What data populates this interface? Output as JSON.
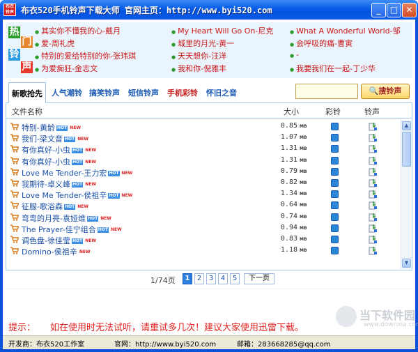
{
  "window": {
    "icon_text": "布衣\n铃声",
    "title": "布衣520手机铃声下载大师   官网主页：http://www.byi520.com"
  },
  "hot_logo": [
    "热",
    "门",
    "铃",
    "声"
  ],
  "hot_links": [
    "其实你不懂我的心-戴月",
    "My Heart Will Go On-尼克",
    "What A Wonderful World-邹",
    "爱-周礼虎",
    "城里的月光-黄一",
    "会呼吸的痛-曹寅",
    "特别的爱给特别的你-张玮琪",
    "天天想你-汪洋",
    "-",
    "为爱痴狂-金志文",
    "我和你-倪雅丰",
    "我要我们在一起-丁少华"
  ],
  "tabs": [
    "新歌抢先",
    "人气潮铃",
    "搞笑铃声",
    "短信铃声",
    "手机彩铃",
    "怀旧之音"
  ],
  "search": {
    "placeholder": "",
    "button_label": "搜铃声"
  },
  "table": {
    "headers": {
      "name": "文件名称",
      "size": "大小",
      "color_ring": "彩铃",
      "ringtone": "铃声"
    },
    "unit": "MB",
    "hot_badge": "HOT",
    "new_badge": "NEW",
    "rows": [
      {
        "name": "特别-黄龄",
        "size": "0.85",
        "hot": true,
        "new": true
      },
      {
        "name": "我们-梁文音",
        "size": "1.07",
        "hot": true,
        "new": true
      },
      {
        "name": "有你真好-小虫",
        "size": "1.31",
        "hot": true,
        "new": true
      },
      {
        "name": "有你真好-小虫",
        "size": "1.31",
        "hot": true,
        "new": true
      },
      {
        "name": "Love Me Tender-王力宏",
        "size": "0.79",
        "hot": true,
        "new": true
      },
      {
        "name": "我期待-卓义峰",
        "size": "0.82",
        "hot": true,
        "new": true
      },
      {
        "name": "Love Me Tender-侯祖辛",
        "size": "1.34",
        "hot": true,
        "new": true
      },
      {
        "name": "征服-歌浴森",
        "size": "0.64",
        "hot": true,
        "new": true
      },
      {
        "name": "弯弯的月亮-袁娅维",
        "size": "0.74",
        "hot": true,
        "new": true
      },
      {
        "name": "The Prayer-佳宁组合",
        "size": "0.94",
        "hot": true,
        "new": true
      },
      {
        "name": "调色盘-徐佳莹",
        "size": "0.83",
        "hot": true,
        "new": true
      },
      {
        "name": "Domino-侯祖辛",
        "size": "1.18",
        "hot": false,
        "new": true
      }
    ]
  },
  "pager": {
    "info": "1/74页",
    "pages": [
      "1",
      "2",
      "3",
      "4",
      "5"
    ],
    "current": "1",
    "next_label": "下一页"
  },
  "tip": {
    "label": "提示：",
    "text": "如在使用时无法试听，请重试多几次！建议大家使用迅雷下载。"
  },
  "watermark": {
    "title": "当下软件园",
    "url": "www.downxia.com"
  },
  "status": {
    "developer": "开发商：布衣520工作室",
    "website": "官网：http://www.byi520.com",
    "email": "邮箱：283668285@qq.com"
  },
  "colors": {
    "titlebar": "#0a5fe8",
    "hot_link": "#c81818",
    "logo_cells": [
      "#e8382c",
      "#2c9ce0",
      "#2c9ce0",
      "#e8382c"
    ]
  }
}
